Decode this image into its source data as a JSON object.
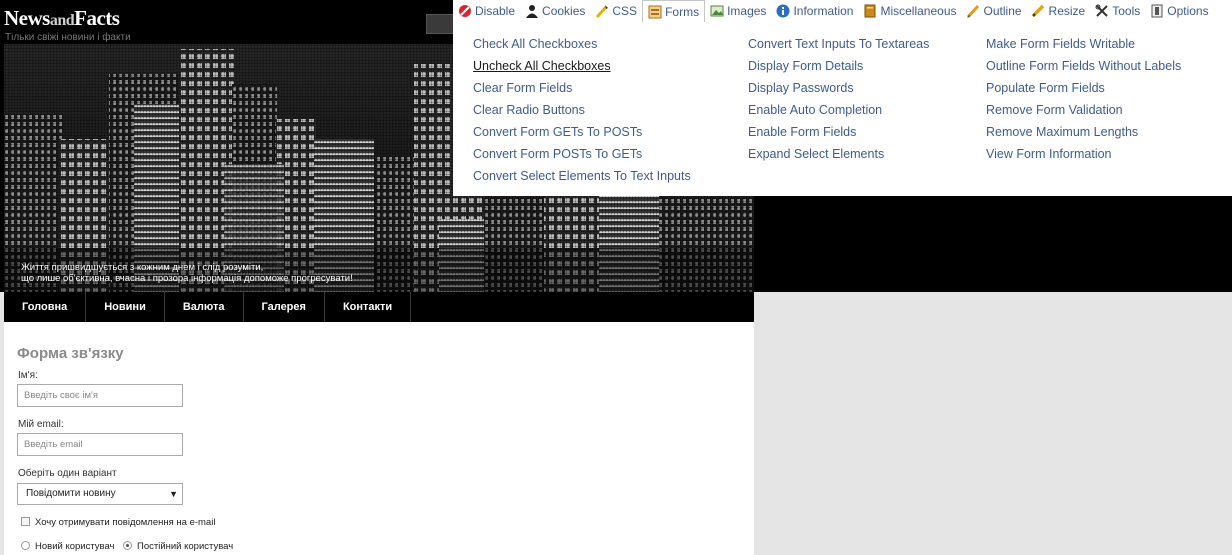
{
  "site": {
    "logo_news": "News",
    "logo_and": "and",
    "logo_facts": "Facts",
    "tagline": "Тільки свіжі новини і факти",
    "banner_caption_line1": "Життя пришвидшується з кожним днем і слід розуміти,",
    "banner_caption_line2": "що лише об'єктивна, вчасна і прозора інформація допоможе прогресувати!"
  },
  "nav": {
    "items": [
      {
        "label": "Головна"
      },
      {
        "label": "Новини"
      },
      {
        "label": "Валюта"
      },
      {
        "label": "Галерея"
      },
      {
        "label": "Контакти"
      }
    ]
  },
  "form": {
    "title": "Форма зв'язку",
    "name_label": "Ім'я:",
    "name_placeholder": "Введіть своє ім'я",
    "email_label": "Мій email:",
    "email_placeholder": "Введіть email",
    "choice_label": "Оберіть один варіант",
    "choice_selected": "Повідомити новину",
    "subscribe_label": "Хочу отримувати повідомлення на e-mail",
    "radio_new": "Новий користувач",
    "radio_regular": "Постійний користувач",
    "radio_regular_checked": true
  },
  "toolbar": {
    "tabs": [
      {
        "label": "Disable",
        "icon": "disable-icon",
        "color": "#d9262e"
      },
      {
        "label": "Cookies",
        "icon": "cookies-icon",
        "color": "#222222"
      },
      {
        "label": "CSS",
        "icon": "css-icon",
        "color": "#e6b400"
      },
      {
        "label": "Forms",
        "icon": "forms-icon",
        "color": "#b36b1f",
        "active": true
      },
      {
        "label": "Images",
        "icon": "images-icon",
        "color": "#4b8a3a"
      },
      {
        "label": "Information",
        "icon": "information-icon",
        "color": "#2b6fc2"
      },
      {
        "label": "Miscellaneous",
        "icon": "miscellaneous-icon",
        "color": "#c98a1a"
      },
      {
        "label": "Outline",
        "icon": "outline-icon",
        "color": "#e39b1b"
      },
      {
        "label": "Resize",
        "icon": "resize-icon",
        "color": "#e0a21f"
      },
      {
        "label": "Tools",
        "icon": "tools-icon",
        "color": "#333333"
      },
      {
        "label": "Options",
        "icon": "options-icon",
        "color": "#555555"
      }
    ],
    "menu_col1": [
      "Check All Checkboxes",
      "Uncheck All Checkboxes",
      "Clear Form Fields",
      "Clear Radio Buttons",
      "Convert Form GETs To POSTs",
      "Convert Form POSTs To GETs",
      "Convert Select Elements To Text Inputs"
    ],
    "menu_col2": [
      "Convert Text Inputs To Textareas",
      "Display Form Details",
      "Display Passwords",
      "Enable Auto Completion",
      "Enable Form Fields",
      "Expand Select Elements"
    ],
    "menu_col3": [
      "Make Form Fields Writable",
      "Outline Form Fields Without Labels",
      "Populate Form Fields",
      "Remove Form Validation",
      "Remove Maximum Lengths",
      "View Form Information"
    ],
    "hovered_item": "Uncheck All Checkboxes"
  }
}
